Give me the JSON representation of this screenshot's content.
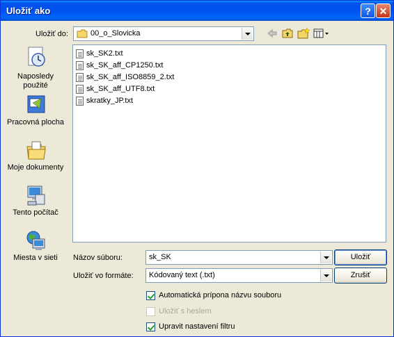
{
  "window": {
    "title": "Uložiť ako"
  },
  "save_in": {
    "label": "Uložiť do:",
    "value": "00_o_Slovicka",
    "folder_icon": "folder-icon"
  },
  "toolbar": {
    "back_icon": "back-arrow-icon",
    "up_icon": "up-folder-icon",
    "new_folder_icon": "new-folder-icon",
    "view_icon": "view-menu-icon"
  },
  "places": [
    {
      "label_line1": "Naposledy",
      "label_line2": "použité",
      "icon": "recent-documents-icon"
    },
    {
      "label_line1": "Pracovná plocha",
      "label_line2": "",
      "icon": "desktop-icon"
    },
    {
      "label_line1": "Moje dokumenty",
      "label_line2": "",
      "icon": "my-documents-icon"
    },
    {
      "label_line1": "Tento počítač",
      "label_line2": "",
      "icon": "my-computer-icon"
    },
    {
      "label_line1": "Miesta v sieti",
      "label_line2": "",
      "icon": "network-places-icon"
    }
  ],
  "files": [
    "sk_SK2.txt",
    "sk_SK_aff_CP1250.txt",
    "sk_SK_aff_ISO8859_2.txt",
    "sk_SK_aff_UTF8.txt",
    "skratky_JP.txt"
  ],
  "filename": {
    "label": "Názov súboru:",
    "value": "sk_SK"
  },
  "format": {
    "label": "Uložiť vo formáte:",
    "value": "Kódovaný text (.txt)"
  },
  "buttons": {
    "save": "Uložiť",
    "cancel": "Zrušiť"
  },
  "options": [
    {
      "label": "Automatická prípona názvu souboru",
      "checked": true,
      "enabled": true
    },
    {
      "label": "Uložiť s heslem",
      "checked": false,
      "enabled": false
    },
    {
      "label": "Upravit nastavení filtru",
      "checked": true,
      "enabled": true
    }
  ]
}
